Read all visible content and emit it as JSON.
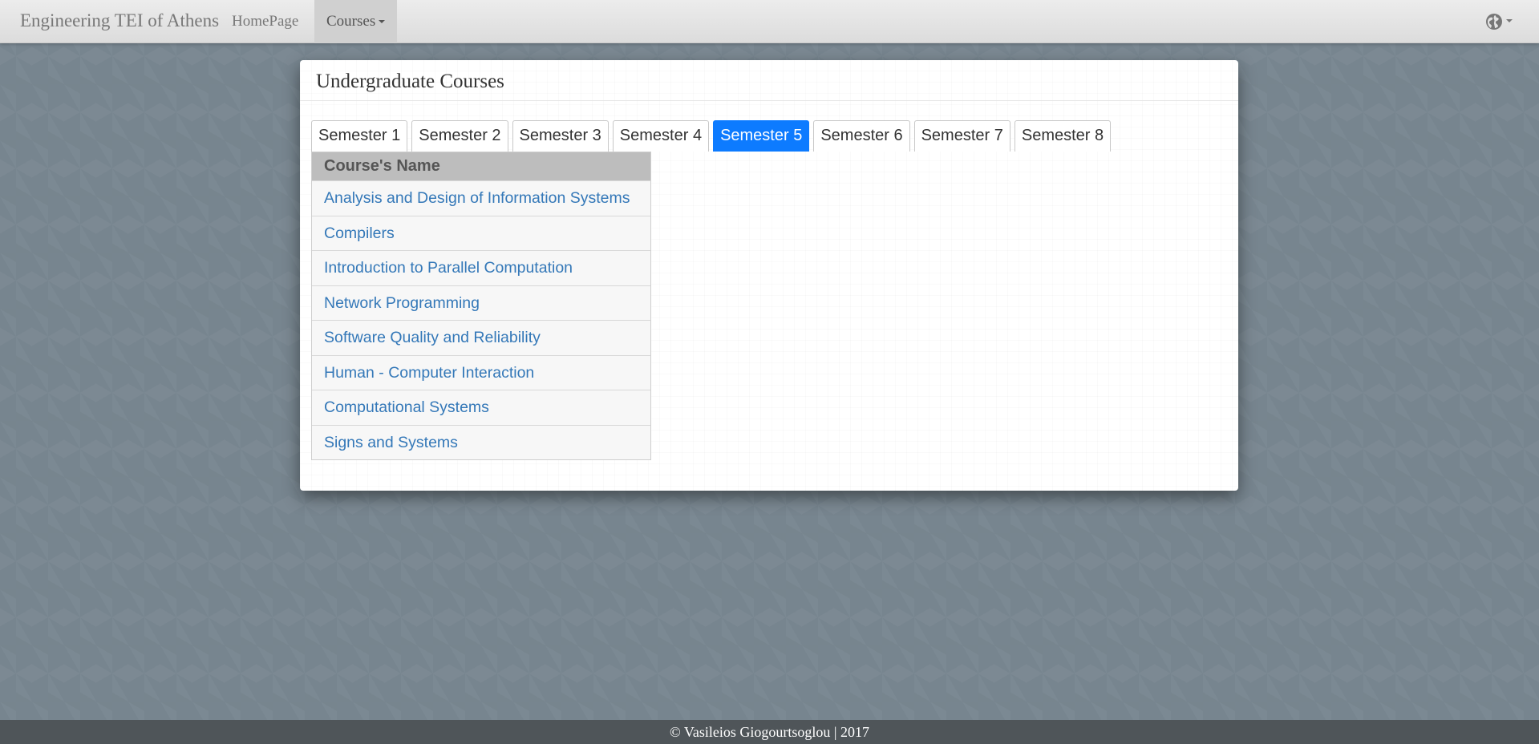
{
  "navbar": {
    "brand": "Engineering TEI of Athens",
    "home": "HomePage",
    "courses": "Courses",
    "language_icon": "globe-icon"
  },
  "panel": {
    "title": "Undergraduate Courses",
    "tabs": [
      {
        "label": "Semester 1"
      },
      {
        "label": "Semester 2"
      },
      {
        "label": "Semester 3"
      },
      {
        "label": "Semester 4"
      },
      {
        "label": "Semester 5",
        "active": true
      },
      {
        "label": "Semester 6"
      },
      {
        "label": "Semester 7"
      },
      {
        "label": "Semester 8"
      }
    ],
    "table_header": "Course's Name",
    "courses": [
      "Analysis and Design of Information Systems",
      "Compilers",
      "Introduction to Parallel Computation",
      "Network Programming",
      "Software Quality and Reliability",
      "Human - Computer Interaction",
      "Computational Systems",
      "Signs and Systems"
    ]
  },
  "footer": {
    "text": "© Vasileios Giogourtsoglou | 2017"
  },
  "colors": {
    "active_tab": "#0d7bff",
    "link": "#3478b8",
    "background": "#77858f"
  }
}
